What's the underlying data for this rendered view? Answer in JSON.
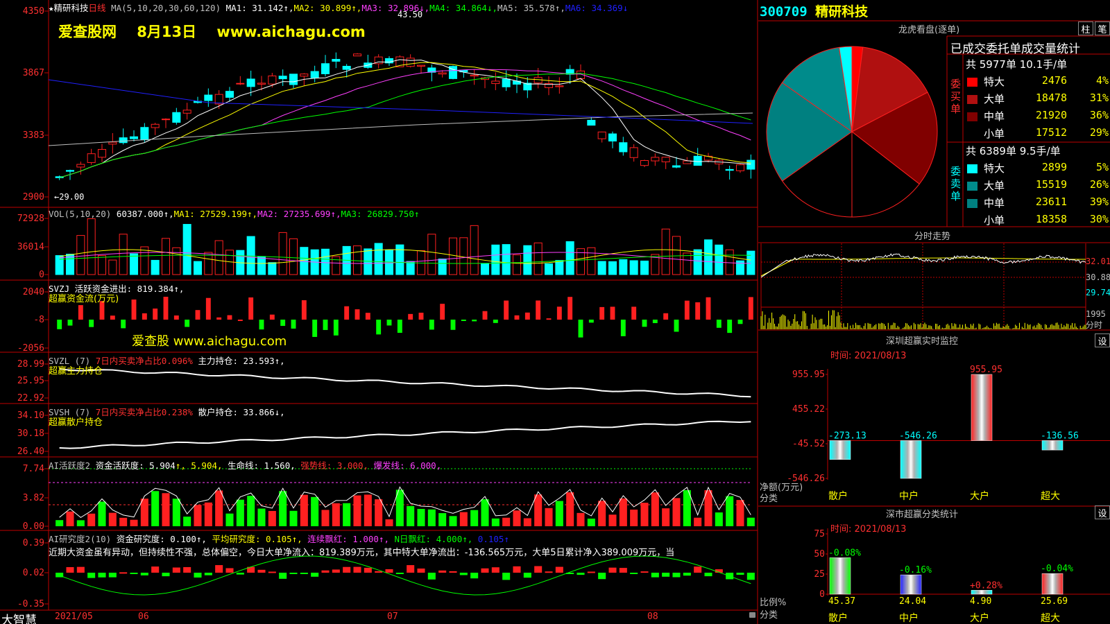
{
  "stock": {
    "code": "300709",
    "name": "精研科技",
    "period": "日线"
  },
  "watermark": {
    "top": "爱查股网    8月13日    www.aichagu.com",
    "mid": "爱查股 www.aichagu.com"
  },
  "bottom": {
    "brand": "大智慧",
    "dates": [
      "2021/05",
      "06",
      "07",
      "08"
    ]
  },
  "panels": {
    "price": {
      "axis": [
        "4350",
        "3867",
        "3383",
        "2900"
      ],
      "legend": [
        {
          "text": "★精研科技",
          "color": "#ffffff"
        },
        {
          "text": "日线",
          "color": "#ff3030"
        },
        {
          "text": " MA(5,10,20,30,60,120) ",
          "color": "#c0c0c0"
        },
        {
          "text": "MA1: 31.142↑,",
          "color": "#ffffff"
        },
        {
          "text": "MA2: 30.899↑,",
          "color": "#ffff00"
        },
        {
          "text": "MA3: 32.896↓,",
          "color": "#ff40ff"
        },
        {
          "text": "MA4: 34.864↓,",
          "color": "#00ff00"
        },
        {
          "text": "MA5: 35.578↑,",
          "color": "#c0c0c0"
        },
        {
          "text": "MA6: 34.369↓",
          "color": "#2020ff"
        }
      ],
      "high_label": "43.50",
      "low_label": "29.00"
    },
    "vol": {
      "axis": [
        "72928",
        "36014",
        "0"
      ],
      "legend": [
        {
          "text": "VOL(5,10,20) ",
          "color": "#c0c0c0"
        },
        {
          "text": "60387.000↑,",
          "color": "#ffffff"
        },
        {
          "text": "MA1: 27529.199↑,",
          "color": "#ffff00"
        },
        {
          "text": "MA2: 27235.699↑,",
          "color": "#ff40ff"
        },
        {
          "text": "MA3: 26829.750↑",
          "color": "#00ff00"
        }
      ]
    },
    "svzj": {
      "axis": [
        "2040",
        "-8",
        "-2056"
      ],
      "legend": [
        {
          "text": "SVZJ  活跃资金进出: 819.384↑,",
          "color": "#ffffff"
        }
      ],
      "sub": "超赢资金流(万元)"
    },
    "svzl": {
      "axis": [
        "28.99",
        "25.95",
        "22.92"
      ],
      "legend": [
        {
          "text": "SVZL (7) ",
          "color": "#c0c0c0"
        },
        {
          "text": "7日内买卖净占比0.096%",
          "color": "#ff3030"
        },
        {
          "text": " 主力持仓: 23.593↑,",
          "color": "#ffffff"
        }
      ],
      "sub": "超赢主力持仓"
    },
    "svsh": {
      "axis": [
        "34.10",
        "30.18",
        "26.40"
      ],
      "legend": [
        {
          "text": "SVSH (7) ",
          "color": "#c0c0c0"
        },
        {
          "text": "7日内买卖净占比0.238%",
          "color": "#ff3030"
        },
        {
          "text": " 散户持仓: 33.866↓,",
          "color": "#ffffff"
        }
      ],
      "sub": "超赢散户持仓"
    },
    "ai1": {
      "axis": [
        "7.74",
        "3.82",
        "0.00"
      ],
      "legend": [
        {
          "text": "AI活跃度2 ",
          "color": "#c0c0c0"
        },
        {
          "text": "资金活跃度: 5.904",
          "color": "#ffffff"
        },
        {
          "text": "↑, 5.904,",
          "color": "#ffff00"
        },
        {
          "text": " 生命线: 1.560,",
          "color": "#ffffff"
        },
        {
          "text": " 强势线: 3.000,",
          "color": "#ff3030"
        },
        {
          "text": " 爆发线: 6.000,",
          "color": "#ff40ff"
        }
      ]
    },
    "ai2": {
      "axis": [
        "0.39",
        "0.02",
        "-0.35"
      ],
      "legend": [
        {
          "text": "AI研究度2(10) ",
          "color": "#c0c0c0"
        },
        {
          "text": "资金研究度: 0.100↑,",
          "color": "#ffffff"
        },
        {
          "text": " 平均研究度: 0.105↑,",
          "color": "#ffff00"
        },
        {
          "text": " 连续飘红: 1.000↑,",
          "color": "#ff40ff"
        },
        {
          "text": " N日飘红: 4.000↑,",
          "color": "#00ff00"
        },
        {
          "text": " 0.105↑",
          "color": "#2020ff"
        }
      ],
      "comment": "近期大资金虽有异动，但持续性不强，总体偏空，今日大单净流入：819.389万元，其中特大单净流出：-136.565万元，大单5日累计净入389.009万元，当"
    }
  },
  "right": {
    "lhb": {
      "title": "龙虎看盘(逐单)",
      "buttons": [
        "柱",
        "笔"
      ],
      "stats_title": "已成交委托单成交量统计",
      "buy": {
        "header": "共 5977单 10.1手/单",
        "label": "委买单",
        "rows": [
          {
            "name": "特大",
            "vol": "2476",
            "pct": "4%",
            "color": "#ff0000"
          },
          {
            "name": "大单",
            "vol": "18478",
            "pct": "31%",
            "color": "#b01010"
          },
          {
            "name": "中单",
            "vol": "21920",
            "pct": "36%",
            "color": "#800000"
          },
          {
            "name": "小单",
            "vol": "17512",
            "pct": "29%",
            "color": "#000000"
          }
        ]
      },
      "sell": {
        "header": "共 6389单 9.5手/单",
        "label": "委卖单",
        "rows": [
          {
            "name": "特大",
            "vol": "2899",
            "pct": "5%",
            "color": "#00ffff"
          },
          {
            "name": "大单",
            "vol": "15519",
            "pct": "26%",
            "color": "#008b8b"
          },
          {
            "name": "中单",
            "vol": "23611",
            "pct": "39%",
            "color": "#008080"
          },
          {
            "name": "小单",
            "vol": "18358",
            "pct": "30%",
            "color": "#000000"
          }
        ]
      }
    },
    "fenshi": {
      "title": "分时走势",
      "axis": [
        "32.01",
        "30.88",
        "29.74"
      ],
      "vol_axis": [
        "1995"
      ],
      "foot": "分时"
    },
    "monitor": {
      "title": "深圳超赢实时监控",
      "btn": "设",
      "time": "时间: 2021/08/13",
      "axis": [
        "955.95",
        "455.22",
        "-45.52",
        "-546.26"
      ],
      "foot": [
        "净额(万元)",
        "分类"
      ]
    },
    "classify": {
      "title": "深市超赢分类统计",
      "btn": "设",
      "time": "时间: 2021/08/13",
      "axis": [
        "75",
        "50",
        "25",
        "0"
      ],
      "foot": [
        "比例%",
        "分类"
      ]
    }
  },
  "chart_data": [
    {
      "type": "pie",
      "title": "已成交委托单成交量统计",
      "series": [
        {
          "name": "委买单",
          "categories": [
            "特大",
            "大单",
            "中单",
            "小单"
          ],
          "values": [
            2476,
            18478,
            21920,
            17512
          ],
          "percent": [
            4,
            31,
            36,
            29
          ]
        },
        {
          "name": "委卖单",
          "categories": [
            "特大",
            "大单",
            "中单",
            "小单"
          ],
          "values": [
            2899,
            15519,
            23611,
            18358
          ],
          "percent": [
            5,
            26,
            39,
            30
          ]
        }
      ]
    },
    {
      "type": "bar",
      "title": "深圳超赢实时监控",
      "ylabel": "净额(万元)",
      "categories": [
        "散户",
        "中户",
        "大户",
        "超大"
      ],
      "values": [
        -273.13,
        -546.26,
        955.95,
        -136.56
      ],
      "ylim": [
        -546.26,
        955.95
      ]
    },
    {
      "type": "bar",
      "title": "深市超赢分类统计",
      "ylabel": "比例%",
      "categories": [
        "散户",
        "中户",
        "大户",
        "超大"
      ],
      "values": [
        45.37,
        24.04,
        4.9,
        25.69
      ],
      "changes": [
        "-0.08%",
        "-0.16%",
        "+0.28%",
        "-0.04%"
      ],
      "ylim": [
        0,
        75
      ]
    },
    {
      "type": "line",
      "title": "日线",
      "note": "daily K-line candlesticks with MA lines, 2021/05 - 2021/08",
      "ylim": [
        29.0,
        43.5
      ]
    }
  ]
}
